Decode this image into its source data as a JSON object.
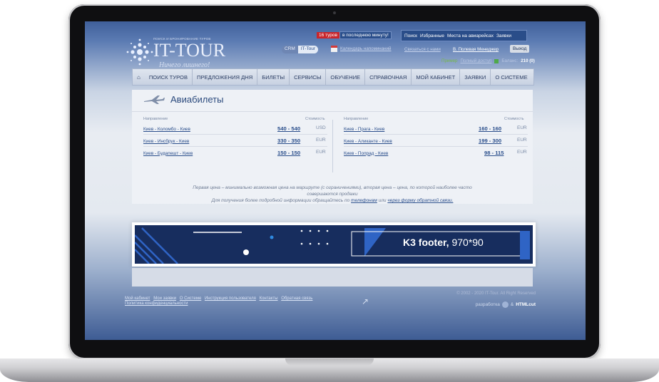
{
  "logo": {
    "tagline": "поиск и бронирование туров",
    "name": "IT-TOUR",
    "slogan": "Ничего лишнего!"
  },
  "header": {
    "hot_badge": "16 туров",
    "hot_text": "в последнюю минуту!",
    "top_links": [
      "Поиск",
      "Избранные",
      "Места на авиарейсах",
      "Заявки"
    ],
    "crm_a": "CRM",
    "crm_b": "IT-Tour",
    "calendar": "Календарь напоминаний",
    "contact": "Связаться с нами",
    "manager": "В. Полевая Менеджер",
    "exit": "Выход",
    "example": "Пример",
    "access": "Полный доступ",
    "balance_label": "Баланс:",
    "balance": "210 (0)"
  },
  "menu": [
    "ПОИСК ТУРОВ",
    "ПРЕДЛОЖЕНИЯ ДНЯ",
    "БИЛЕТЫ",
    "СЕРВИСЫ",
    "ОБУЧЕНИЕ",
    "СПРАВОЧНАЯ",
    "МОЙ КАБИНЕТ",
    "ЗАЯВКИ",
    "О СИСТЕМЕ"
  ],
  "page": {
    "title": "Авиабилеты",
    "col_direction": "Направление",
    "col_cost": "Стоимость",
    "left_rows": [
      {
        "route": "Киев - Коломбо - Киев",
        "price": "540 - 540",
        "cur": "USD"
      },
      {
        "route": "Киев - Инсбрук - Киев",
        "price": "330 - 350",
        "cur": "EUR"
      },
      {
        "route": "Киев - Будапешт - Киев",
        "price": "150 - 150",
        "cur": "EUR"
      }
    ],
    "right_rows": [
      {
        "route": "Киев - Прага - Киев",
        "price": "160 - 160",
        "cur": "EUR"
      },
      {
        "route": "Киев - Аликанте - Киев",
        "price": "199 - 300",
        "cur": "EUR"
      },
      {
        "route": "Киев - Попрад - Киев",
        "price": "98 - 115",
        "cur": "EUR"
      }
    ],
    "note1": "Первая цена – минимально возможная цена на маршруте (с ограничениями), вторая цена – цена, по которой наиболее часто",
    "note2": "совершаются продажи",
    "note3_a": "Для получения более подробной информации обращайтесь по",
    "note3_link1": "телефонам",
    "note3_b": "или",
    "note3_link2": "через форму обратной связи."
  },
  "banner": {
    "label_bold": "K3 footer,",
    "label_size": "970*90"
  },
  "footer": {
    "links": [
      "Мой кабинет",
      "Мои заявки",
      "О Системе",
      "Инструкция пользователя",
      "Контакты",
      "Обратная связь"
    ],
    "policy": "Политика конфиденциальности",
    "copyright": "© 2002 - 2020 IT-Tour. All Right Reserved",
    "dev_label": "разработка",
    "dev_name": "HTMLcut"
  }
}
